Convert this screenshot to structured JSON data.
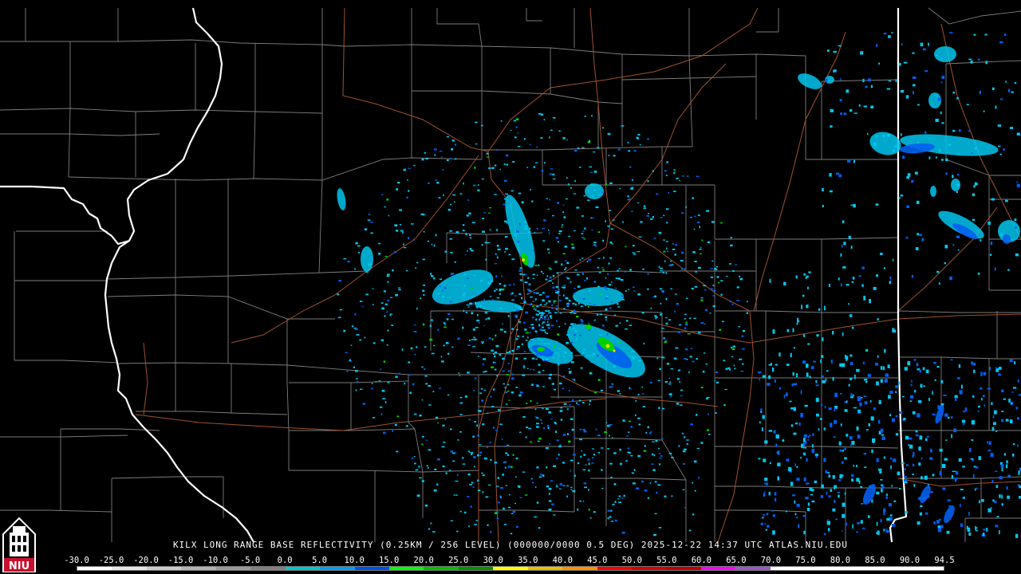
{
  "product": {
    "caption": "KILX LONG RANGE BASE REFLECTIVITY (0.25KM / 256 LEVEL) (000000/0000 0.5 DEG) 2025-12-22 14:37 UTC  ATLAS.NIU.EDU"
  },
  "logo": {
    "text": "NIU",
    "icon": "university-tower-icon",
    "background_color": "#c8102e"
  },
  "colorbar": {
    "ticks": [
      "-30.0",
      "-25.0",
      "-20.0",
      "-15.0",
      "-10.0",
      "-5.0",
      "0.0",
      "5.0",
      "10.0",
      "15.0",
      "20.0",
      "25.0",
      "30.0",
      "35.0",
      "40.0",
      "45.0",
      "50.0",
      "55.0",
      "60.0",
      "65.0",
      "70.0",
      "75.0",
      "80.0",
      "85.0",
      "90.0",
      "94.5"
    ],
    "colors": [
      "#ffffff",
      "#e6e6e6",
      "#cccccc",
      "#b3b3b3",
      "#9a9a9a",
      "#808080",
      "#00c8c8",
      "#00a0f0",
      "#0050f0",
      "#00ff00",
      "#00c000",
      "#009000",
      "#ffff00",
      "#e7c000",
      "#ff9000",
      "#ff0000",
      "#d60000",
      "#c00000",
      "#ff00ff",
      "#9955c9",
      "#ffffff",
      "#ffffff",
      "#ffffff",
      "#ffffff",
      "#ffffff"
    ]
  },
  "map_colors": {
    "background": "#000000",
    "state_border": "#ffffff",
    "county_border": "#7d7d7d",
    "highway": "#a0522d",
    "echo_light": "#00c8f0",
    "echo_mid": "#0060f0",
    "echo_strong": "#00d000",
    "echo_peak": "#e0e000"
  }
}
